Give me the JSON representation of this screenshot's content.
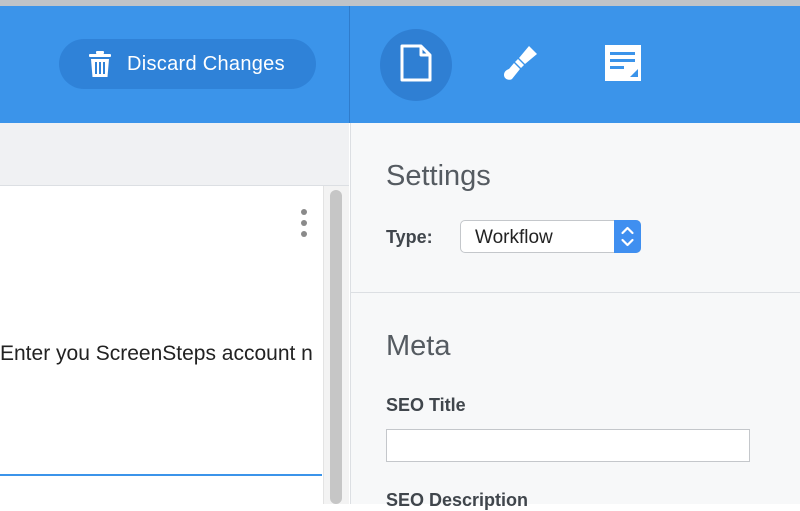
{
  "toolbar": {
    "discard_label": "Discard Changes",
    "tools": [
      {
        "icon": "document-icon",
        "active": true
      },
      {
        "icon": "brush-icon",
        "active": false
      },
      {
        "icon": "note-edit-icon",
        "active": false
      }
    ],
    "accent_color": "#3b94ea"
  },
  "editor": {
    "body_text": "Enter you ScreenSteps account n"
  },
  "settings": {
    "heading": "Settings",
    "type_label": "Type:",
    "type_value": "Workflow"
  },
  "meta": {
    "heading": "Meta",
    "seo_title_label": "SEO Title",
    "seo_title_value": "",
    "seo_description_label": "SEO Description"
  }
}
